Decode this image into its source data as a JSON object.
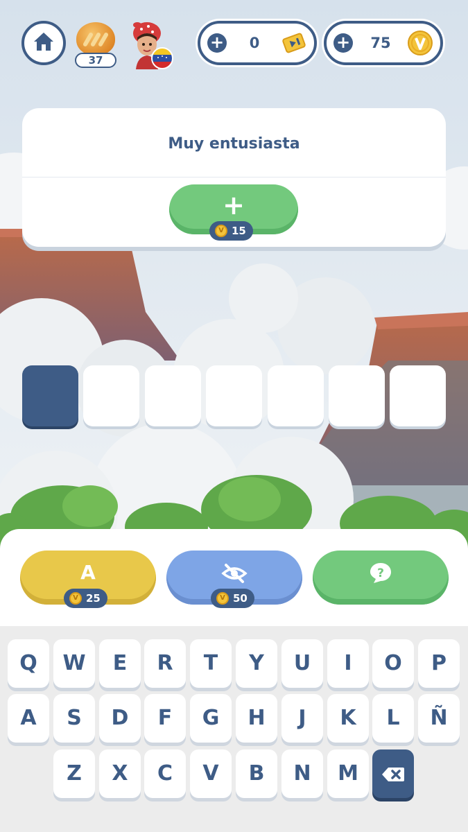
{
  "topbar": {
    "level": "37",
    "tickets": "0",
    "coins": "75",
    "icons": [
      "home-icon",
      "bread-icon",
      "avatar",
      "flag-icon",
      "plus-icon",
      "ticket-icon",
      "coin-icon"
    ]
  },
  "clue": {
    "text": "Muy entusiasta",
    "add_cost": "15"
  },
  "answer": {
    "length": 7,
    "active_index": 0
  },
  "tools": {
    "reveal_letter_glyph": "A",
    "reveal_letter_cost": "25",
    "remove_letters_cost": "50",
    "help_glyph": "?"
  },
  "keyboard": {
    "row1": [
      "Q",
      "W",
      "E",
      "R",
      "T",
      "Y",
      "U",
      "I",
      "O",
      "P"
    ],
    "row2": [
      "A",
      "S",
      "D",
      "F",
      "G",
      "H",
      "J",
      "K",
      "L",
      "Ñ"
    ],
    "row3": [
      "Z",
      "X",
      "C",
      "V",
      "B",
      "N",
      "M"
    ]
  },
  "colors": {
    "primary": "#3e5c86",
    "green": "#73c97d",
    "yellow": "#e8c84a",
    "blue": "#7ea5e6",
    "coin": "#f3c43b"
  }
}
